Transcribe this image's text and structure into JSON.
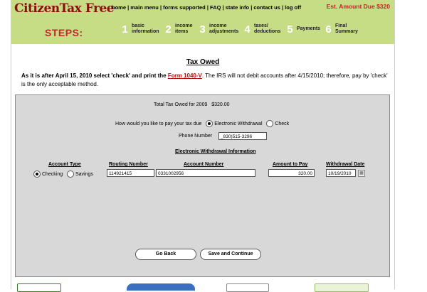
{
  "header": {
    "logo": "CitizenTax Free",
    "steps_label": "STEPS:",
    "amount_due": "Est. Amount Due $320",
    "nav": [
      "home",
      "main menu",
      "forms supported",
      "FAQ",
      "state info",
      "contact us",
      "log off"
    ],
    "steps": [
      {
        "num": "1",
        "line1": "basic",
        "line2": "information"
      },
      {
        "num": "2",
        "line1": "income",
        "line2": "items"
      },
      {
        "num": "3",
        "line1": "income",
        "line2": "adjustments"
      },
      {
        "num": "4",
        "line1": "taxes/",
        "line2": "deductions"
      },
      {
        "num": "5",
        "line1": "Payments",
        "line2": ""
      },
      {
        "num": "6",
        "line1": "Final",
        "line2": "Summary"
      }
    ]
  },
  "page_title": "Tax Owed",
  "notice": {
    "bold_part": "As it is after April 15, 2010 select 'check' and print the",
    "link": "Form 1040-V",
    "rest": ". The IRS will not debit accounts after 4/15/2010; therefore, pay by 'check' is the only acceptable method."
  },
  "form": {
    "total_label": "Total Tax Owed for 2009",
    "total_value": "$320.00",
    "pay_question": "How would you like to pay your  tax due",
    "pay_options": [
      "Electronic Withdrawal",
      "Check"
    ],
    "phone_label": "Phone Number",
    "phone_value": "_830)515-3296",
    "ew_heading": "Electronic Withdrawal Information",
    "col_account_type": "Account Type",
    "col_routing": "Routing Number",
    "col_account_number": "Account Number",
    "col_amount": "Amount to Pay",
    "col_withdrawal_date": "Withdrawal Date",
    "account_types": [
      "Checking",
      "Savings"
    ],
    "routing_value": "114921415",
    "account_value": "0331002956",
    "amount_value": "320.00",
    "date_value": "10/19/2010"
  },
  "buttons": {
    "back": "Go Back",
    "save": "Save and Continue"
  },
  "colors": {
    "header_bg": "#c6dd86",
    "logo": "#8a1010",
    "accent_red": "#c0282a",
    "panel_bg": "#d8d8d8"
  }
}
